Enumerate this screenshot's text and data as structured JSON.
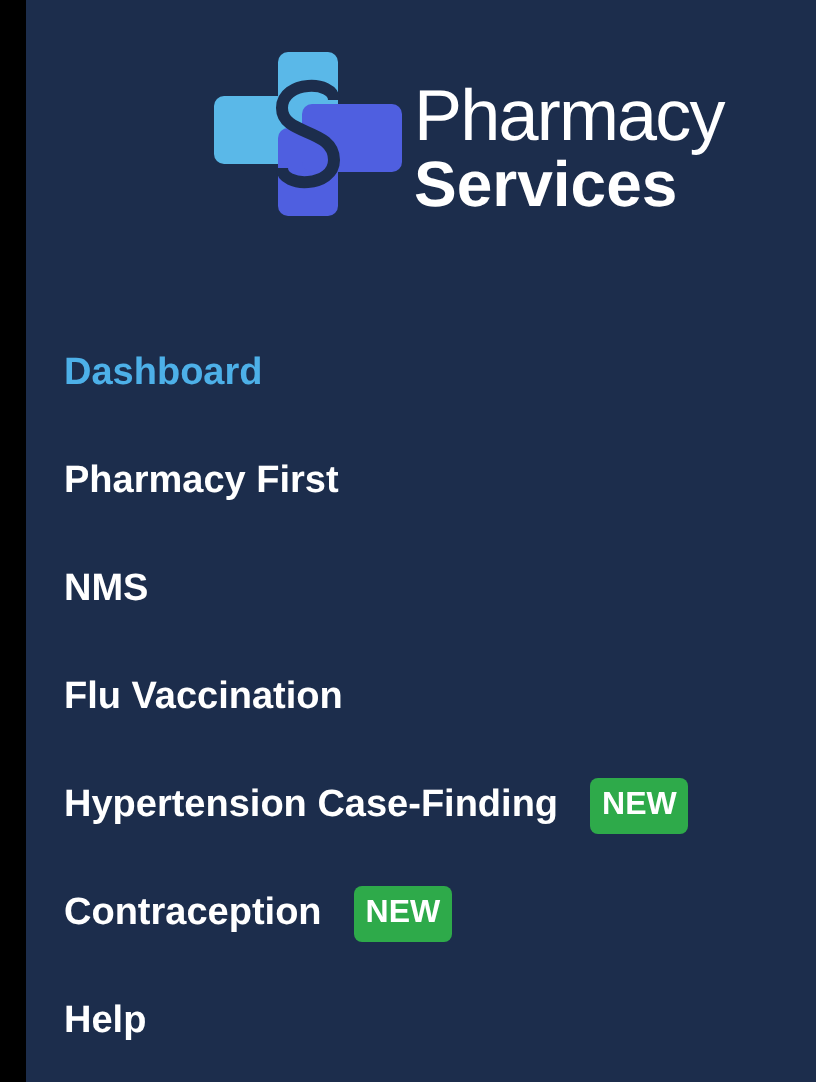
{
  "logo": {
    "line_1": "Pharmacy",
    "line_2": "Services"
  },
  "nav": [
    {
      "label": "Dashboard",
      "selected": true
    },
    {
      "label": "Pharmacy First",
      "selected": false
    },
    {
      "label": "NMS",
      "selected": false
    },
    {
      "label": "Flu Vaccination",
      "selected": false
    },
    {
      "label": "Hypertension Case-Finding",
      "selected": false,
      "badge": "NEW"
    },
    {
      "label": "Contraception",
      "selected": false,
      "badge": "NEW"
    },
    {
      "label": "Help",
      "selected": false
    }
  ]
}
